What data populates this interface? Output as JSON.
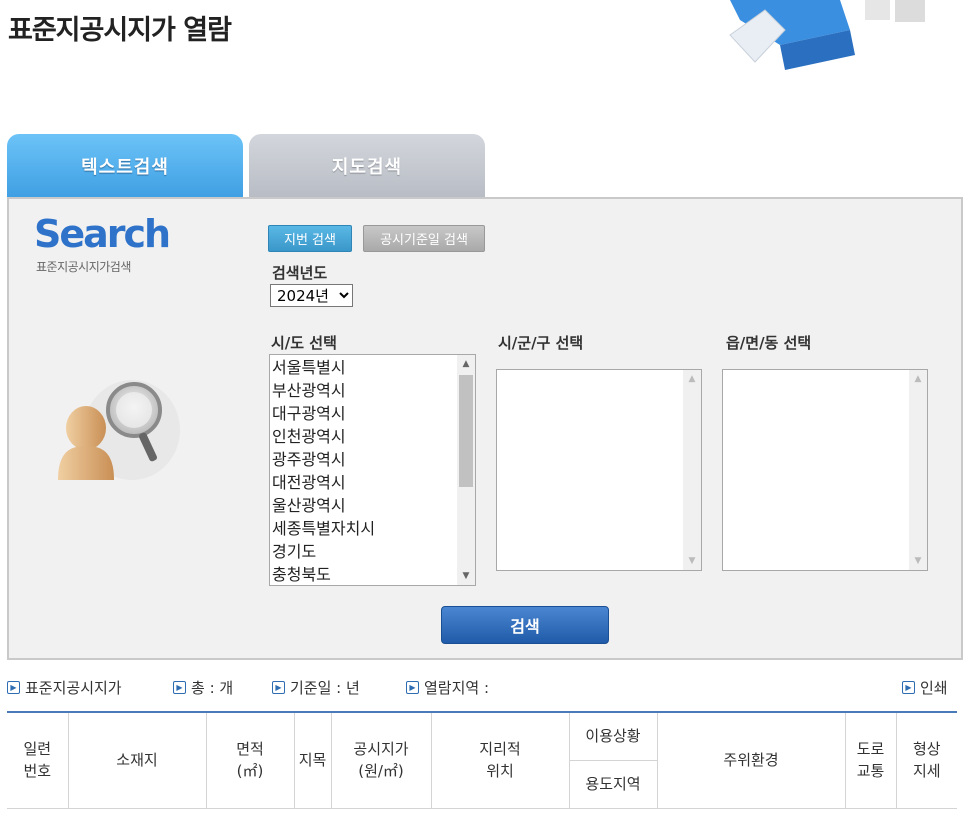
{
  "page": {
    "title": "표준지공시지가 열람"
  },
  "tabs": [
    {
      "label": "텍스트검색"
    },
    {
      "label": "지도검색"
    }
  ],
  "search_logo": {
    "title": "Search",
    "subtitle": "표준지공시지가검색"
  },
  "buttons": {
    "lot_search": "지번 검색",
    "date_search": "공시기준일 검색",
    "search": "검색",
    "print": "인쇄"
  },
  "year": {
    "label": "검색년도",
    "selected": "2024년"
  },
  "selectors": {
    "sido_label": "시/도 선택",
    "sigungu_label": "시/군/구 선택",
    "eupmyeondong_label": "읍/면/동 선택",
    "sido_items": [
      "서울특별시",
      "부산광역시",
      "대구광역시",
      "인천광역시",
      "광주광역시",
      "대전광역시",
      "울산광역시",
      "세종특별자치시",
      "경기도",
      "충청북도"
    ]
  },
  "info_bar": {
    "item1": "표준지공시지가",
    "item2": "총 : 개",
    "item3": "기준일 : 년",
    "item4": "열람지역 :"
  },
  "table": {
    "col_serial_1": "일련",
    "col_serial_2": "번호",
    "col_address": "소재지",
    "col_area_1": "면적",
    "col_area_2": "(㎡)",
    "col_category": "지목",
    "col_price_1": "공시지가",
    "col_price_2": "(원/㎡)",
    "col_geo_1": "지리적",
    "col_geo_2": "위치",
    "col_usage": "이용상황",
    "col_zone": "용도지역",
    "col_surround": "주위환경",
    "col_road_1": "도로",
    "col_road_2": "교통",
    "col_shape_1": "형상",
    "col_shape_2": "지세"
  },
  "colors": {
    "accent_blue": "#3f9fe3",
    "button_blue": "#1f5ba8",
    "tab_gray": "#b8bcc4"
  }
}
